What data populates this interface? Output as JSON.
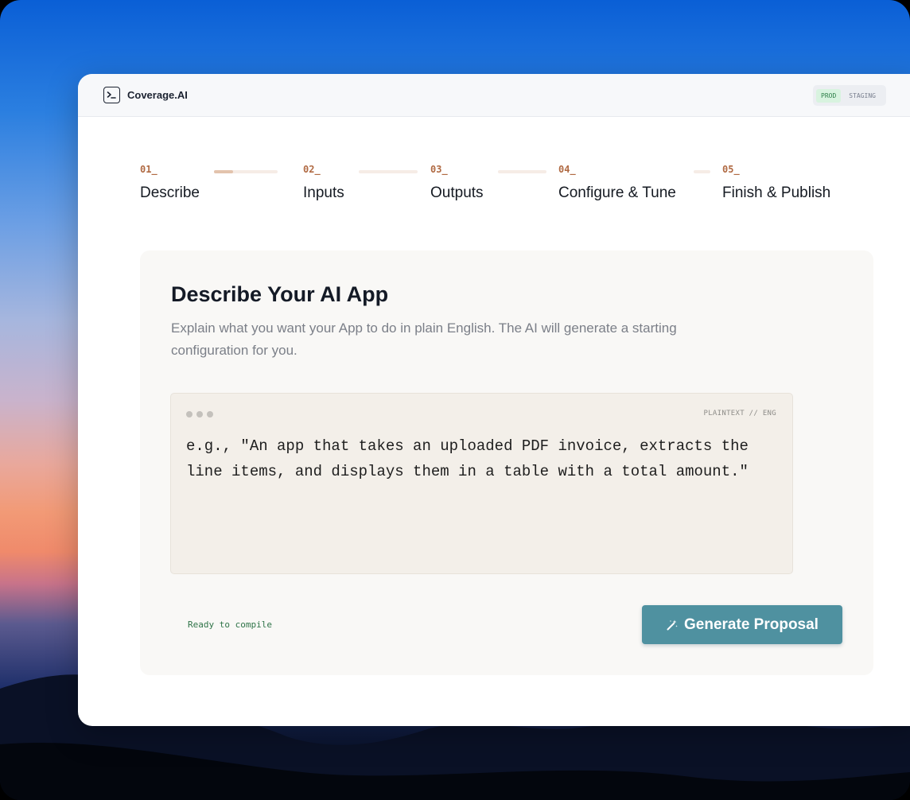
{
  "app": {
    "name": "Coverage.AI",
    "logo_icon": "terminal-prompt-icon"
  },
  "environment": {
    "options": [
      "PROD",
      "STAGING"
    ],
    "active": "PROD"
  },
  "steps": [
    {
      "number": "01_",
      "label": "Describe",
      "progress": 0.3
    },
    {
      "number": "02_",
      "label": "Inputs",
      "progress": 0
    },
    {
      "number": "03_",
      "label": "Outputs",
      "progress": 0
    },
    {
      "number": "04_",
      "label": "Configure & Tune",
      "progress": 0
    },
    {
      "number": "05_",
      "label": "Finish & Publish"
    }
  ],
  "main": {
    "title": "Describe Your AI App",
    "description": "Explain what you want your App to do in plain English. The AI will generate a starting configuration for you.",
    "editor": {
      "language_tag": "PLAINTEXT // ENG",
      "placeholder": "e.g., \"An app that takes an uploaded PDF invoice, extracts the line items, and displays them in a table with a total amount.\""
    },
    "status_text": "Ready to compile",
    "generate_button": {
      "label": "Generate Proposal",
      "icon": "magic-wand-icon"
    }
  },
  "colors": {
    "accent": "#4f91a0",
    "step_number": "#b06a43",
    "status": "#2f7448",
    "active_env_bg": "#d8f3df"
  }
}
